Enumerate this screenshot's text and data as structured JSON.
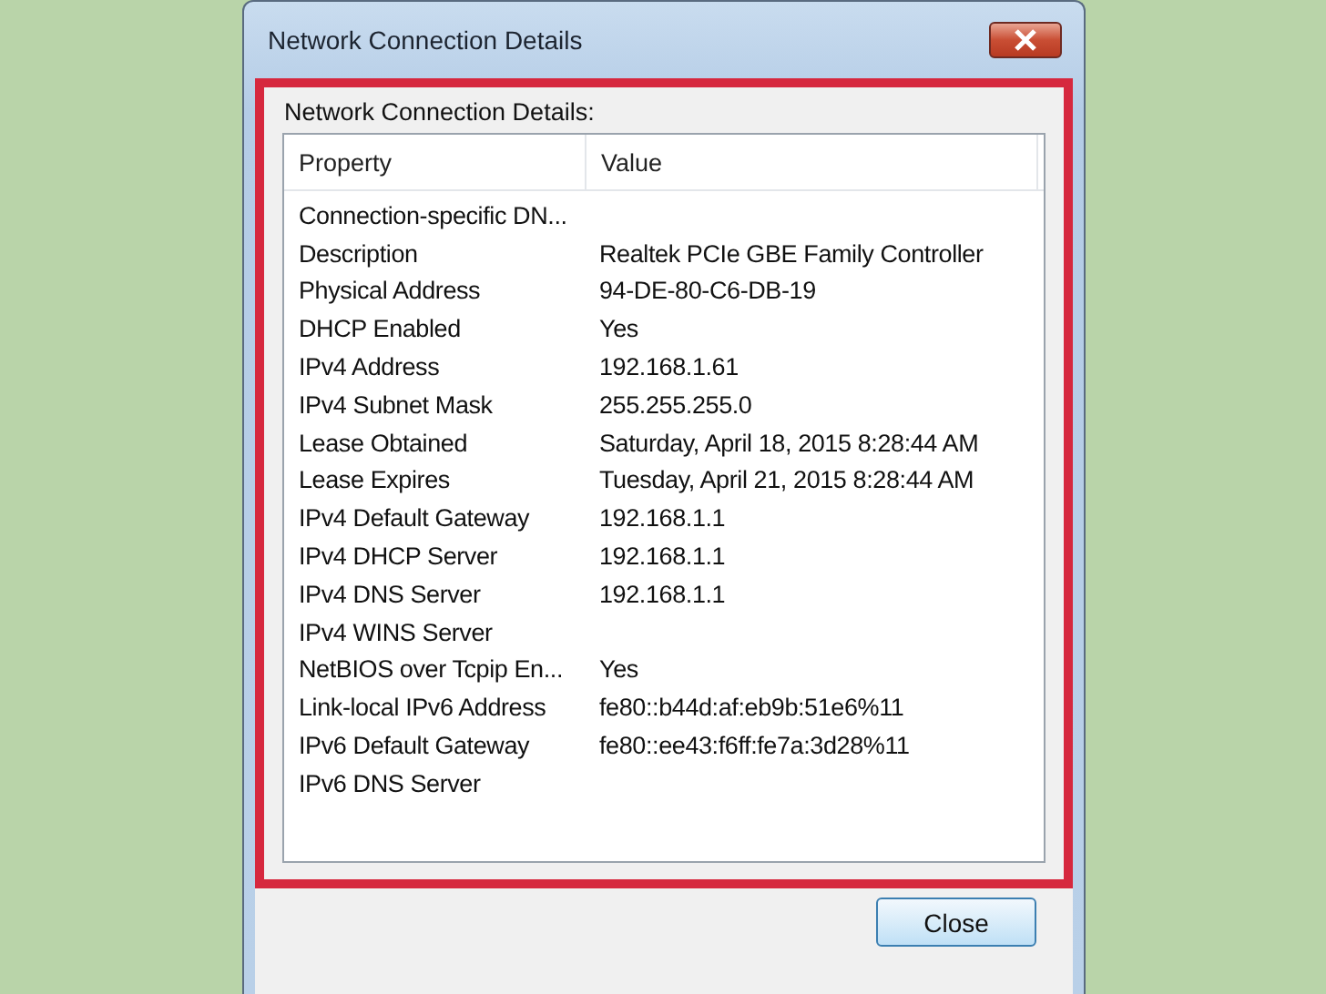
{
  "window": {
    "title": "Network Connection Details"
  },
  "details_label": "Network Connection Details:",
  "table": {
    "columns": [
      "Property",
      "Value"
    ],
    "rows": [
      {
        "property": "Connection-specific DN...",
        "value": ""
      },
      {
        "property": "Description",
        "value": "Realtek PCIe GBE Family Controller"
      },
      {
        "property": "Physical Address",
        "value": "94-DE-80-C6-DB-19"
      },
      {
        "property": "DHCP Enabled",
        "value": "Yes"
      },
      {
        "property": "IPv4 Address",
        "value": "192.168.1.61"
      },
      {
        "property": "IPv4 Subnet Mask",
        "value": "255.255.255.0"
      },
      {
        "property": "Lease Obtained",
        "value": "Saturday, April 18, 2015 8:28:44 AM"
      },
      {
        "property": "Lease Expires",
        "value": "Tuesday, April 21, 2015 8:28:44 AM"
      },
      {
        "property": "IPv4 Default Gateway",
        "value": "192.168.1.1"
      },
      {
        "property": "IPv4 DHCP Server",
        "value": "192.168.1.1"
      },
      {
        "property": "IPv4 DNS Server",
        "value": "192.168.1.1"
      },
      {
        "property": "IPv4 WINS Server",
        "value": ""
      },
      {
        "property": "NetBIOS over Tcpip En...",
        "value": "Yes"
      },
      {
        "property": "Link-local IPv6 Address",
        "value": "fe80::b44d:af:eb9b:51e6%11"
      },
      {
        "property": "IPv6 Default Gateway",
        "value": "fe80::ee43:f6ff:fe7a:3d28%11"
      },
      {
        "property": "IPv6 DNS Server",
        "value": ""
      }
    ]
  },
  "buttons": [
    "Close"
  ]
}
